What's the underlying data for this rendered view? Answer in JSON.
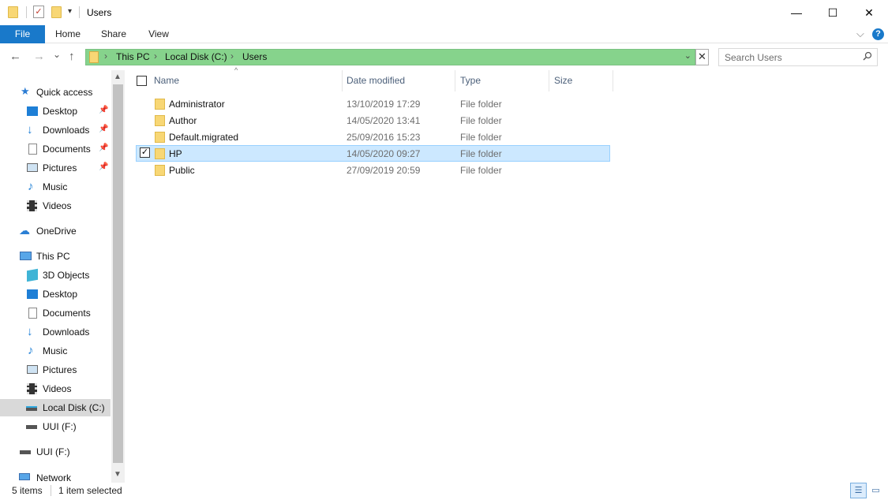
{
  "window": {
    "title": "Users",
    "minimize": "—",
    "maximize": "☐",
    "close": "✕"
  },
  "ribbon": {
    "tabs": [
      "File",
      "Home",
      "Share",
      "View"
    ],
    "collapse": "⌵",
    "help": "?"
  },
  "nav": {
    "back": "←",
    "forward": "→",
    "recent": "⌄",
    "up": "↑"
  },
  "address": {
    "crumbs": [
      "This PC",
      "Local Disk (C:)",
      "Users"
    ],
    "separator": "›",
    "dropdown": "⌄",
    "clear": "✕"
  },
  "search": {
    "placeholder": "Search Users"
  },
  "sidebar": {
    "quick_access": "Quick access",
    "qa_items": [
      {
        "label": "Desktop",
        "icon": "desktop-icon",
        "pinned": true
      },
      {
        "label": "Downloads",
        "icon": "downloads-icon",
        "pinned": true
      },
      {
        "label": "Documents",
        "icon": "documents-icon",
        "pinned": true
      },
      {
        "label": "Pictures",
        "icon": "pictures-icon",
        "pinned": true
      },
      {
        "label": "Music",
        "icon": "music-icon",
        "pinned": false
      },
      {
        "label": "Videos",
        "icon": "videos-icon",
        "pinned": false
      }
    ],
    "onedrive": "OneDrive",
    "this_pc": "This PC",
    "pc_items": [
      {
        "label": "3D Objects",
        "icon": "3d-objects-icon"
      },
      {
        "label": "Desktop",
        "icon": "desktop-icon"
      },
      {
        "label": "Documents",
        "icon": "documents-icon"
      },
      {
        "label": "Downloads",
        "icon": "downloads-icon"
      },
      {
        "label": "Music",
        "icon": "music-icon"
      },
      {
        "label": "Pictures",
        "icon": "pictures-icon"
      },
      {
        "label": "Videos",
        "icon": "videos-icon"
      },
      {
        "label": "Local Disk (C:)",
        "icon": "local-disk-icon",
        "selected": true
      },
      {
        "label": "UUI (F:)",
        "icon": "usb-drive-icon"
      }
    ],
    "uui": "UUI (F:)",
    "network": "Network",
    "pin_glyph": "📌"
  },
  "columns": {
    "name": "Name",
    "date": "Date modified",
    "type": "Type",
    "size": "Size",
    "sort_glyph": "^"
  },
  "files": [
    {
      "name": "Administrator",
      "date": "13/10/2019 17:29",
      "type": "File folder",
      "selected": false
    },
    {
      "name": "Author",
      "date": "14/05/2020 13:41",
      "type": "File folder",
      "selected": false
    },
    {
      "name": "Default.migrated",
      "date": "25/09/2016 15:23",
      "type": "File folder",
      "selected": false
    },
    {
      "name": "HP",
      "date": "14/05/2020 09:27",
      "type": "File folder",
      "selected": true
    },
    {
      "name": "Public",
      "date": "27/09/2019 20:59",
      "type": "File folder",
      "selected": false
    }
  ],
  "status": {
    "count": "5 items",
    "selection": "1 item selected"
  },
  "colors": {
    "accent": "#1979ca",
    "address_bg": "#86d38c",
    "selection": "#cce8ff"
  }
}
